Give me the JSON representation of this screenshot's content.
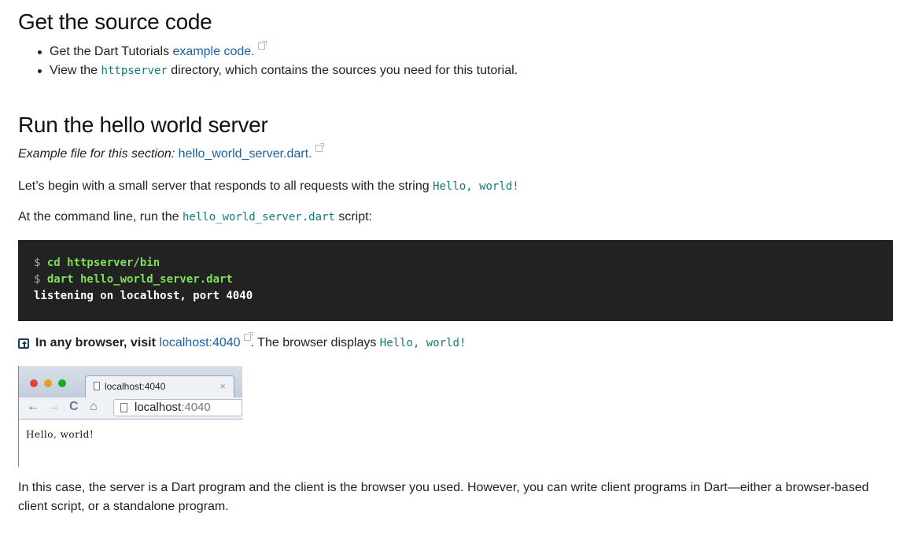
{
  "source_section": {
    "heading": "Get the source code",
    "bullet1": {
      "text": "Get the Dart Tutorials ",
      "link": "example code."
    },
    "bullet2": {
      "before": "View the ",
      "code": "httpserver",
      "after": " directory, which contains the sources you need for this tutorial."
    }
  },
  "run_section": {
    "heading": "Run the hello world server",
    "example_label": "Example file for this section: ",
    "example_link": "hello_world_server.dart.",
    "begin": {
      "text": "Let’s begin with a small server that responds to all requests with the string ",
      "code": "Hello, world!"
    },
    "cmdline": {
      "before": "At the command line, run the ",
      "code": "hello_world_server.dart",
      "after": " script:"
    }
  },
  "terminal": {
    "line1": {
      "prompt": "$ ",
      "cmd": "cd httpserver/bin"
    },
    "line2": {
      "prompt": "$ ",
      "cmd": "dart hello_world_server.dart"
    },
    "line3": "listening on localhost, port 4040"
  },
  "browser_instruction": {
    "icon": "try-it-icon",
    "bold": "In any browser, visit ",
    "link": "localhost:4040",
    "after": ". The browser displays ",
    "code": "Hello, world!"
  },
  "browser_screenshot": {
    "tab_title": "localhost:4040",
    "tab_close": "×",
    "url_host": "localhost",
    "url_port": ":4040",
    "nav_back": "←",
    "nav_forward": "→",
    "nav_reload": "C",
    "nav_home": "⌂",
    "content": "Hello, world!",
    "traffic_lights": {
      "red": "#e0443e",
      "yellow": "#dea123",
      "green": "#1aab29"
    }
  },
  "conclusion": "In this case, the server is a Dart program and the client is the browser you used. However, you can write client programs in Dart—either a browser-based client script, or a standalone program.",
  "colors": {
    "link": "#1a62a8",
    "inline_code": "#137a7a",
    "terminal_bg": "#222222",
    "terminal_cmd": "#7fe05a"
  }
}
